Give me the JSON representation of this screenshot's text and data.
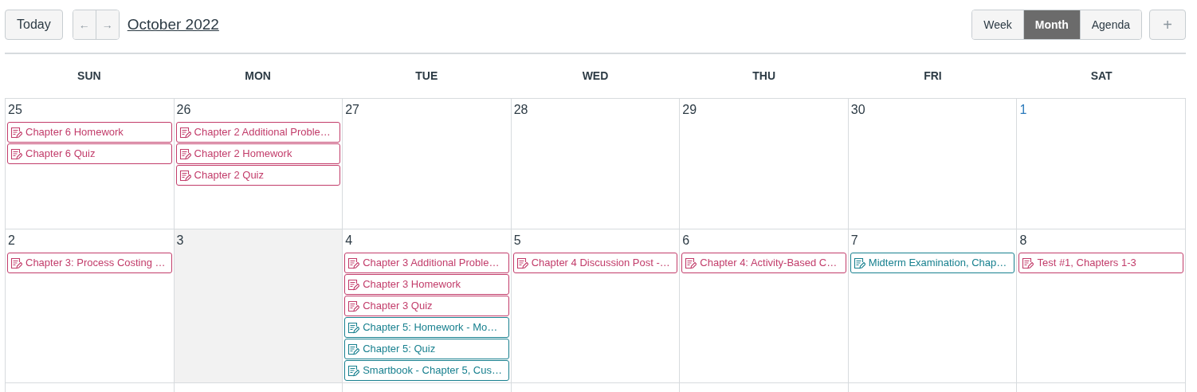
{
  "toolbar": {
    "today_button": "Today",
    "prev_button": "←",
    "next_button": "→",
    "title": "October 2022",
    "view_tabs": [
      {
        "label": "Week",
        "selected": false
      },
      {
        "label": "Month",
        "selected": true
      },
      {
        "label": "Agenda",
        "selected": false
      }
    ],
    "add_button": "+"
  },
  "weekdays": [
    "SUN",
    "MON",
    "TUE",
    "WED",
    "THU",
    "FRI",
    "SAT"
  ],
  "weeks": [
    {
      "days": [
        {
          "number": "25",
          "today": false,
          "link": false,
          "events": [
            {
              "title": "Chapter 6 Homework",
              "color": "#c23c6a"
            },
            {
              "title": "Chapter 6 Quiz",
              "color": "#c23c6a"
            }
          ]
        },
        {
          "number": "26",
          "today": false,
          "link": false,
          "events": [
            {
              "title": "Chapter 2 Additional Proble…",
              "color": "#c23c6a"
            },
            {
              "title": "Chapter 2 Homework",
              "color": "#c23c6a"
            },
            {
              "title": "Chapter 2 Quiz",
              "color": "#c23c6a"
            }
          ]
        },
        {
          "number": "27",
          "today": false,
          "link": false
        },
        {
          "number": "28",
          "today": false,
          "link": false
        },
        {
          "number": "29",
          "today": false,
          "link": false
        },
        {
          "number": "30",
          "today": false,
          "link": false
        },
        {
          "number": "1",
          "today": false,
          "link": true
        }
      ]
    },
    {
      "days": [
        {
          "number": "2",
          "today": false,
          "link": false,
          "events": [
            {
              "title": "Chapter 3: Process Costing …",
              "color": "#c23c6a"
            }
          ]
        },
        {
          "number": "3",
          "today": true,
          "link": false
        },
        {
          "number": "4",
          "today": false,
          "link": false,
          "events": [
            {
              "title": "Chapter 3 Additional Proble…",
              "color": "#c23c6a"
            },
            {
              "title": "Chapter 3 Homework",
              "color": "#c23c6a"
            },
            {
              "title": "Chapter 3 Quiz",
              "color": "#c23c6a"
            },
            {
              "title": "Chapter 5: Homework - Mo…",
              "color": "#18808f"
            },
            {
              "title": "Chapter 5: Quiz",
              "color": "#18808f"
            },
            {
              "title": "Smartbook - Chapter 5, Cus…",
              "color": "#18808f"
            }
          ]
        },
        {
          "number": "5",
          "today": false,
          "link": false,
          "events": [
            {
              "title": "Chapter 4 Discussion Post -…",
              "color": "#c23c6a"
            }
          ]
        },
        {
          "number": "6",
          "today": false,
          "link": false,
          "events": [
            {
              "title": "Chapter 4: Activity-Based C…",
              "color": "#c23c6a"
            }
          ]
        },
        {
          "number": "7",
          "today": false,
          "link": false,
          "events": [
            {
              "title": "Midterm Examination, Chap…",
              "color": "#18808f"
            }
          ]
        },
        {
          "number": "8",
          "today": false,
          "link": false,
          "events": [
            {
              "title": "Test #1, Chapters 1-3",
              "color": "#c23c6a"
            }
          ]
        }
      ]
    }
  ]
}
